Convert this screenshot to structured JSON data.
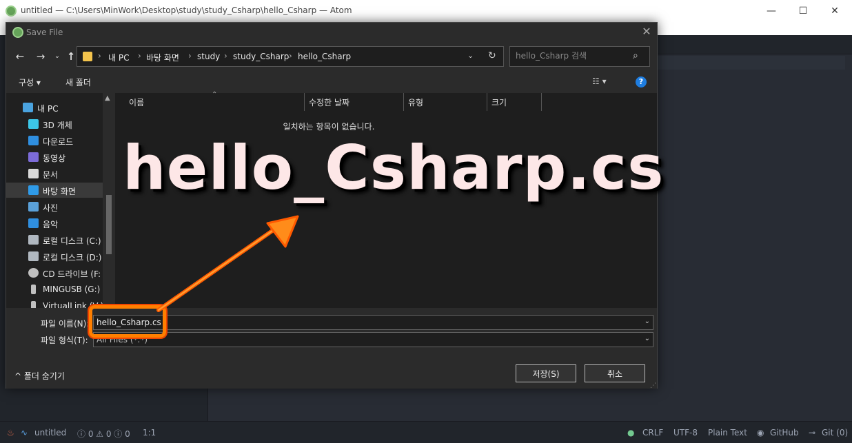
{
  "atom": {
    "title": "untitled — C:\\Users\\MinWork\\Desktop\\study\\study_Csharp\\hello_Csharp — Atom",
    "minimize": "—",
    "maximize": "☐",
    "close": "✕"
  },
  "status": {
    "file": "untitled",
    "diagnostics": "ⓘ 0 ⚠ 0 ⓘ 0",
    "position": "1:1",
    "line_ending": "CRLF",
    "encoding": "UTF-8",
    "grammar": "Plain Text",
    "github": "GitHub",
    "git": "Git (0)"
  },
  "dialog": {
    "title": "Save File",
    "close": "✕",
    "breadcrumbs": [
      "내 PC",
      "바탕 화면",
      "study",
      "study_Csharp",
      "hello_Csharp"
    ],
    "search_placeholder": "hello_Csharp 검색",
    "toolbar": {
      "organize": "구성 ▾",
      "new_folder": "새 폴더",
      "view": "☷ ▾",
      "help": "?"
    },
    "nav_items": [
      {
        "label": "내 PC",
        "icon": "pc-icon",
        "color": "#4aa3df"
      },
      {
        "label": "3D 개체",
        "icon": "cube-icon",
        "color": "#3cc7e8"
      },
      {
        "label": "다운로드",
        "icon": "download-icon",
        "color": "#2f8fe0"
      },
      {
        "label": "동영상",
        "icon": "video-icon",
        "color": "#7c6bd8"
      },
      {
        "label": "문서",
        "icon": "document-icon",
        "color": "#d9d9d9"
      },
      {
        "label": "바탕 화면",
        "icon": "desktop-icon",
        "color": "#2f9be8"
      },
      {
        "label": "사진",
        "icon": "picture-icon",
        "color": "#5aa0d8"
      },
      {
        "label": "음악",
        "icon": "music-icon",
        "color": "#2f8fe0"
      },
      {
        "label": "로컬 디스크 (C:)",
        "icon": "drive-icon",
        "color": "#b0b8c0"
      },
      {
        "label": "로컬 디스크 (D:)",
        "icon": "drive-icon",
        "color": "#b0b8c0"
      },
      {
        "label": "CD 드라이브 (F:",
        "icon": "cd-icon",
        "color": "#c0c0c0"
      },
      {
        "label": "MINGUSB (G:)",
        "icon": "usb-icon",
        "color": "#c0c0c0"
      },
      {
        "label": "VirtualLink (V:)",
        "icon": "usb-icon",
        "color": "#c0c0c0"
      }
    ],
    "columns": [
      "이름",
      "수정한 날짜",
      "유형",
      "크기"
    ],
    "empty_message": "일치하는 항목이 없습니다.",
    "filename_label": "파일 이름(N):",
    "filename_value": "hello_Csharp.cs",
    "filetype_label": "파일 형식(T):",
    "filetype_value": "All Files (*.*)",
    "hide_folders": "^ 폴더 숨기기",
    "save_button": "저장(S)",
    "cancel_button": "취소"
  },
  "overlay": {
    "caption": "hello_Csharp.cs",
    "accent_color": "#ff7f00"
  }
}
